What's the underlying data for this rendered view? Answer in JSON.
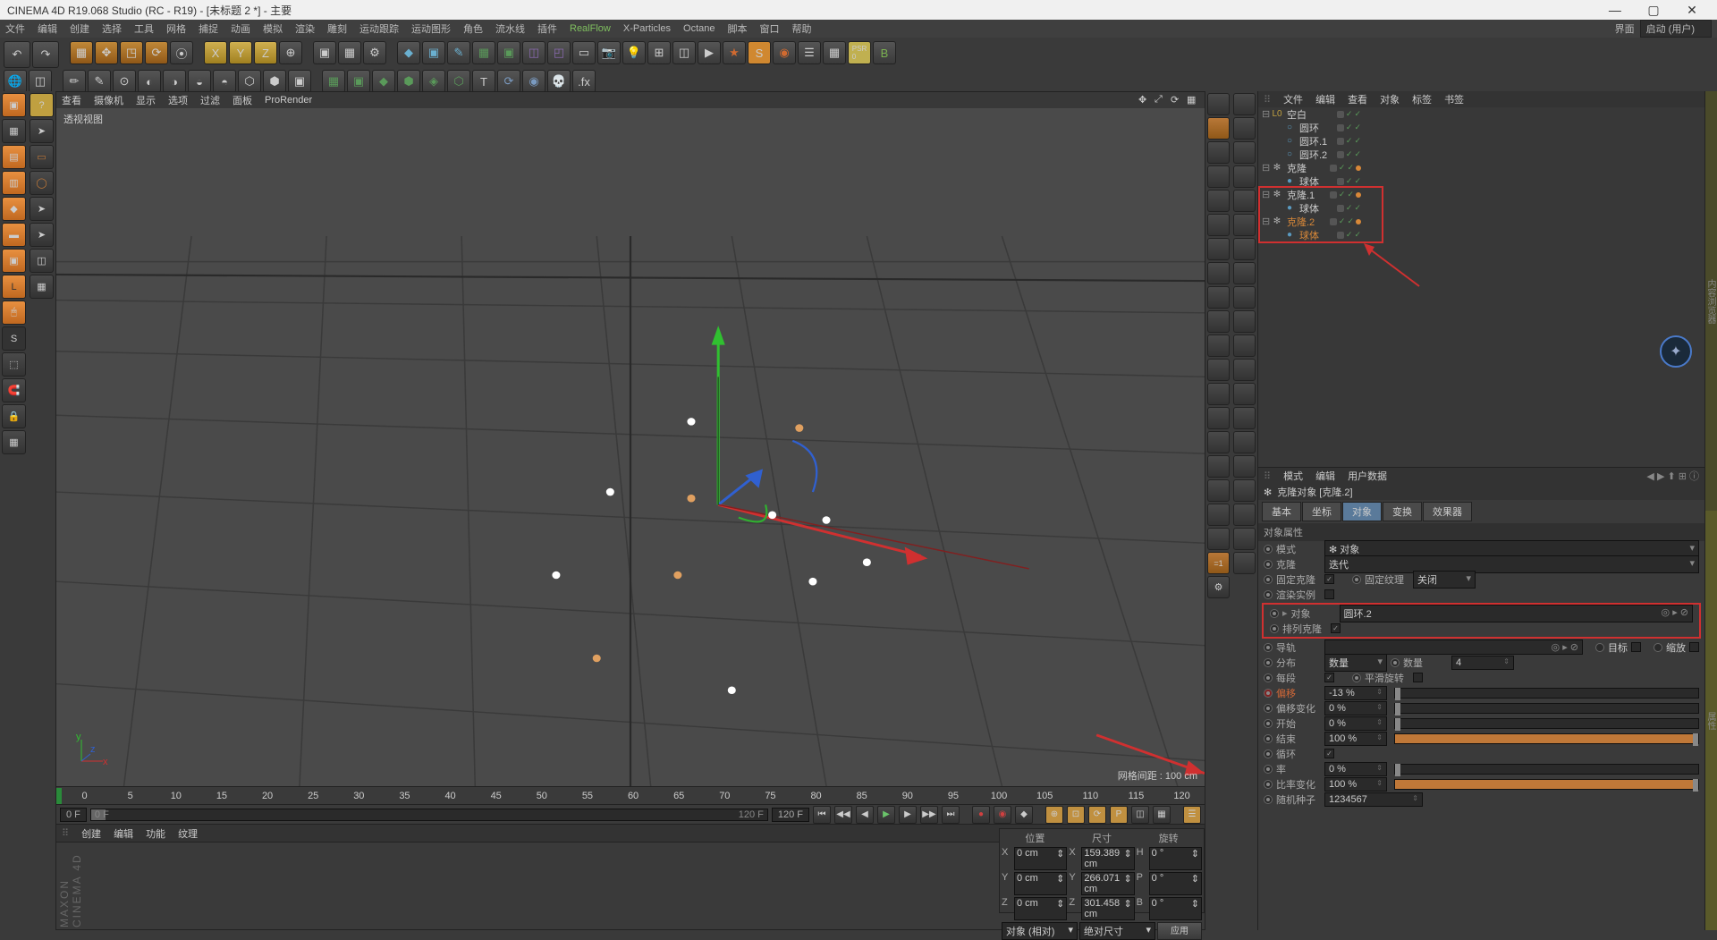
{
  "title": "CINEMA 4D R19.068 Studio (RC - R19) - [未标题 2 *] - 主要",
  "layout_label": "界面",
  "layout_value": "启动 (用户)",
  "menu": [
    "文件",
    "编辑",
    "创建",
    "选择",
    "工具",
    "网格",
    "捕捉",
    "动画",
    "模拟",
    "渲染",
    "雕刻",
    "运动跟踪",
    "运动图形",
    "角色",
    "流水线",
    "插件"
  ],
  "menu_plugins": [
    "RealFlow",
    "X-Particles",
    "Octane",
    "脚本",
    "窗口",
    "帮助"
  ],
  "view_menu": [
    "查看",
    "摄像机",
    "显示",
    "选项",
    "过滤",
    "面板",
    "ProRender"
  ],
  "view_label": "透视视图",
  "grid_label": "网格间距 : 100 cm",
  "timeline_ticks": [
    "0",
    "5",
    "10",
    "15",
    "20",
    "25",
    "30",
    "35",
    "40",
    "45",
    "50",
    "55",
    "60",
    "65",
    "70",
    "75",
    "80",
    "85",
    "90",
    "95",
    "100",
    "105",
    "110",
    "115",
    "120"
  ],
  "frame_start": "0 F",
  "frame_cursor": "0 F",
  "frame_end_slider": "120 F",
  "frame_end": "120 F",
  "obj_tabs": [
    "文件",
    "编辑",
    "查看",
    "对象",
    "标签",
    "书签"
  ],
  "tree": [
    {
      "depth": 0,
      "exp": "⊟",
      "icon": "L0",
      "name": "空白",
      "tags": [
        "g",
        "c",
        "c"
      ]
    },
    {
      "depth": 1,
      "exp": "",
      "icon": "○",
      "name": "圆环",
      "tags": [
        "g",
        "c",
        "c"
      ]
    },
    {
      "depth": 1,
      "exp": "",
      "icon": "○",
      "name": "圆环.1",
      "tags": [
        "g",
        "c",
        "c"
      ]
    },
    {
      "depth": 1,
      "exp": "",
      "icon": "○",
      "name": "圆环.2",
      "tags": [
        "g",
        "c",
        "c"
      ]
    },
    {
      "depth": 0,
      "exp": "⊟",
      "icon": "✻",
      "name": "克隆",
      "tags": [
        "g",
        "c",
        "c",
        "o"
      ]
    },
    {
      "depth": 1,
      "exp": "",
      "icon": "●",
      "name": "球体",
      "tags": [
        "g",
        "c",
        "c"
      ]
    },
    {
      "depth": 0,
      "exp": "⊟",
      "icon": "✻",
      "name": "克隆.1",
      "tags": [
        "g",
        "c",
        "c",
        "o"
      ]
    },
    {
      "depth": 1,
      "exp": "",
      "icon": "●",
      "name": "球体",
      "tags": [
        "g",
        "c",
        "c"
      ]
    },
    {
      "depth": 0,
      "exp": "⊟",
      "icon": "✻",
      "name": "克隆.2",
      "sel": true,
      "tags": [
        "g",
        "c",
        "c",
        "o"
      ]
    },
    {
      "depth": 1,
      "exp": "",
      "icon": "●",
      "name": "球体",
      "sel": true,
      "tags": [
        "g",
        "c",
        "c"
      ]
    }
  ],
  "attr_tabs_menu": [
    "模式",
    "编辑",
    "用户数据"
  ],
  "attr_title": "克隆对象 [克隆.2]",
  "attr_tabs": [
    "基本",
    "坐标",
    "对象",
    "变换",
    "效果器"
  ],
  "attr_active_tab": "对象",
  "section": "对象属性",
  "prop_mode_lbl": "模式",
  "prop_mode_val": "对象",
  "prop_clone_lbl": "克隆",
  "prop_clone_val": "迭代",
  "prop_fixclone_lbl": "固定克隆",
  "prop_fixtex_lbl": "固定纹理",
  "prop_fixtex_val": "关闭",
  "prop_inst_lbl": "渲染实例",
  "prop_obj_lbl": "对象",
  "prop_obj_val": "圆环.2",
  "prop_align_lbl": "排列克隆",
  "prop_rail_lbl": "导轨",
  "prop_rail_target": "目标",
  "prop_rail_scale": "缩放",
  "prop_dist_lbl": "分布",
  "prop_dist_val": "数量",
  "prop_count_lbl": "数量",
  "prop_count_val": "4",
  "prop_step_lbl": "每段",
  "prop_smooth_lbl": "平滑旋转",
  "prop_offset_lbl": "偏移",
  "prop_offset_val": "-13 %",
  "prop_offvar_lbl": "偏移变化",
  "prop_offvar_val": "0 %",
  "prop_start_lbl": "开始",
  "prop_start_val": "0 %",
  "prop_end_lbl": "结束",
  "prop_end_val": "100 %",
  "prop_loop_lbl": "循环",
  "prop_rate_lbl": "率",
  "prop_rate_val": "0 %",
  "prop_ratechg_lbl": "比率变化",
  "prop_ratechg_val": "100 %",
  "prop_seed_lbl": "随机种子",
  "prop_seed_val": "1234567",
  "coord": {
    "hdr": [
      "位置",
      "尺寸",
      "旋转"
    ],
    "rows": [
      {
        "ax": "X",
        "p": "0 cm",
        "s": "159.389 cm",
        "r": "0 °",
        "sm": "H"
      },
      {
        "ax": "Y",
        "p": "0 cm",
        "s": "266.071 cm",
        "r": "0 °",
        "sm": "P"
      },
      {
        "ax": "Z",
        "p": "0 cm",
        "s": "301.458 cm",
        "r": "0 °",
        "sm": "B"
      }
    ],
    "mode1": "对象 (相对)",
    "mode2": "绝对尺寸",
    "apply": "应用"
  },
  "mat_tabs": [
    "创建",
    "编辑",
    "功能",
    "纹理"
  ],
  "brand": "MAXON CINEMA 4D"
}
